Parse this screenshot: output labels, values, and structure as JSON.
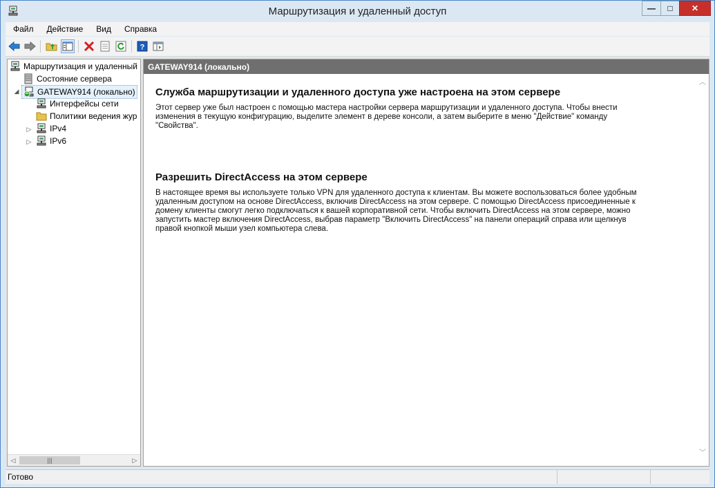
{
  "window": {
    "title": "Маршрутизация и удаленный доступ",
    "min_glyph": "—",
    "max_glyph": "□",
    "close_glyph": "✕"
  },
  "menu": [
    {
      "label": "Файл"
    },
    {
      "label": "Действие"
    },
    {
      "label": "Вид"
    },
    {
      "label": "Справка"
    }
  ],
  "toolbar": {
    "icons": [
      "back-arrow-icon",
      "forward-arrow-icon",
      "up-folder-icon",
      "show-hide-tree-icon",
      "delete-icon",
      "properties-icon",
      "refresh-icon",
      "help-icon",
      "console-icon"
    ]
  },
  "tree": {
    "root": "Маршрутизация и удаленный",
    "server_status": "Состояние сервера",
    "server": "GATEWAY914 (локально)",
    "interfaces": "Интерфейсы сети",
    "policies": "Политики ведения жур",
    "ipv4": "IPv4",
    "ipv6": "IPv6"
  },
  "content": {
    "header": "GATEWAY914 (локально)",
    "section1_title": "Служба маршрутизации и удаленного доступа уже настроена на этом сервере",
    "section1_lines": [
      "Этот сервер уже был настроен с помощью мастера настройки сервера маршрутизации и удаленного доступа. Чтобы внести",
      "изменения в текущую конфигурацию, выделите элемент в дереве консоли, а затем выберите в меню \"Действие\" команду",
      "\"Свойства\"."
    ],
    "section2_title": "Разрешить DirectAccess на этом сервере",
    "section2_lines": [
      "В настоящее время вы используете только VPN для удаленного доступа к клиентам. Вы можете воспользоваться более удобным",
      "удаленным доступом на основе DirectAccess, включив DirectAccess на этом сервере. С помощью DirectAccess присоединенные к",
      "домену клиенты смогут легко подключаться к вашей корпоративной сети. Чтобы включить DirectAccess на этом сервере, можно",
      "запустить мастер включения DirectAccess, выбрав параметр \"Включить DirectAccess\" на панели операций справа или щелкнув",
      "правой кнопкой мыши узел компьютера слева."
    ]
  },
  "status": {
    "text": "Готово"
  }
}
